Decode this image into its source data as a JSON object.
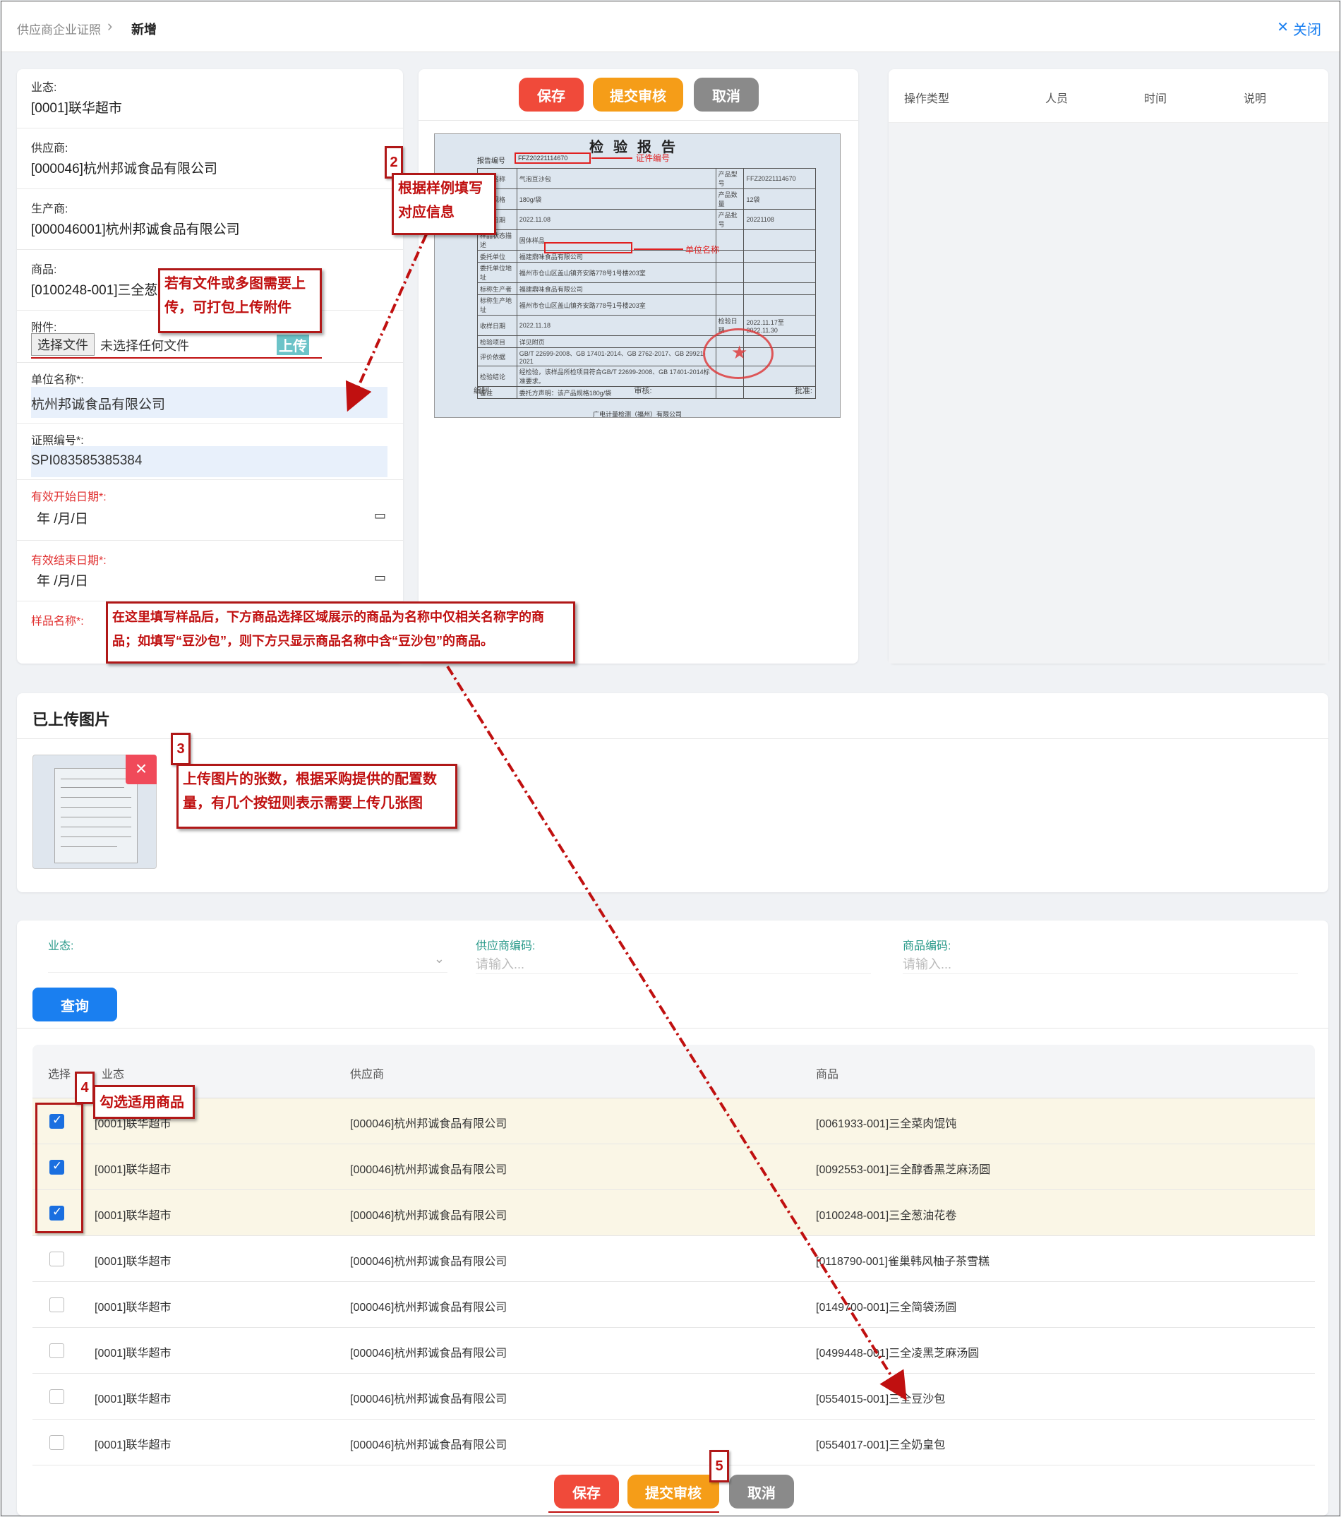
{
  "breadcrumb": {
    "parent": "供应商企业证照",
    "current": "新增"
  },
  "close_label": "关闭",
  "form": {
    "business_label": "业态:",
    "business_value": "[0001]联华超市",
    "supplier_label": "供应商:",
    "supplier_value": "[000046]杭州邦诚食品有限公司",
    "producer_label": "生产商:",
    "producer_value": "[000046001]杭州邦诚食品有限公司",
    "product_label": "商品:",
    "product_value": "[0100248-001]三全葱",
    "attach_label": "附件:",
    "choose_file": "选择文件",
    "no_file": "未选择任何文件",
    "upload": "上传",
    "unit_label": "单位名称*:",
    "unit_value": "杭州邦诚食品有限公司",
    "license_label": "证照编号*:",
    "license_value": "SPI083585385384",
    "start_label": "有效开始日期*:",
    "start_value": "年 /月/日",
    "end_label": "有效结束日期*:",
    "end_value": "年 /月/日",
    "sample_label": "样品名称*:"
  },
  "toolbar": {
    "save": "保存",
    "submit": "提交审核",
    "cancel": "取消"
  },
  "report": {
    "title": "检验报告",
    "no_label": "报告编号",
    "no_value": "FFZ20221114670",
    "no_tag": "证件编号",
    "unit_tag": "单位名称",
    "rows": [
      [
        "产品名称",
        "气泡豆沙包",
        "产品型号",
        "FFZ20221114670"
      ],
      [
        "产品规格",
        "180g/袋",
        "产品数量",
        "12袋"
      ],
      [
        "生产日期",
        "2022.11.08",
        "产品批号",
        "20221108"
      ],
      [
        "样品状态描述",
        "固体样品",
        "",
        ""
      ],
      [
        "委托单位",
        "福建鼎味食品有限公司",
        "",
        ""
      ],
      [
        "委托单位地址",
        "福州市仓山区盖山镇齐安路778号1号楼203室",
        "",
        ""
      ],
      [
        "标称生产者",
        "福建鼎味食品有限公司",
        "",
        ""
      ],
      [
        "标称生产地址",
        "福州市仓山区盖山镇齐安路778号1号楼203室",
        "",
        ""
      ],
      [
        "收样日期",
        "2022.11.18",
        "检验日期",
        "2022.11.17至2022.11.30"
      ],
      [
        "检验项目",
        "详见附页",
        "",
        ""
      ],
      [
        "评价依据",
        "GB/T 22699-2008、GB 17401-2014、GB 2762-2017、GB 29921-2021",
        "",
        ""
      ],
      [
        "检验结论",
        "经检验，该样品所检项目符合GB/T 22699-2008、GB 17401-2014标准要求。",
        "",
        ""
      ],
      [
        "备注",
        "委托方声明：该产品规格180g/袋",
        "",
        ""
      ]
    ],
    "signer1": "编制:",
    "signer2": "审核:",
    "signer3": "批准:",
    "footer": "广电计量检测（福州）有限公司"
  },
  "log": {
    "headers": [
      "操作类型",
      "人员",
      "时间",
      "说明"
    ]
  },
  "uploaded": {
    "title": "已上传图片",
    "remove": "×"
  },
  "search": {
    "business_label": "业态:",
    "supplier_code_label": "供应商编码:",
    "supplier_code_placeholder": "请输入...",
    "product_code_label": "商品编码:",
    "product_code_placeholder": "请输入...",
    "query": "查询"
  },
  "table": {
    "headers": [
      "选择",
      "业态",
      "供应商",
      "商品"
    ],
    "rows": [
      {
        "checked": true,
        "business": "[0001]联华超市",
        "supplier": "[000046]杭州邦诚食品有限公司",
        "product": "[0061933-001]三全菜肉馄饨"
      },
      {
        "checked": true,
        "business": "[0001]联华超市",
        "supplier": "[000046]杭州邦诚食品有限公司",
        "product": "[0092553-001]三全醇香黑芝麻汤圆"
      },
      {
        "checked": true,
        "business": "[0001]联华超市",
        "supplier": "[000046]杭州邦诚食品有限公司",
        "product": "[0100248-001]三全葱油花卷"
      },
      {
        "checked": false,
        "business": "[0001]联华超市",
        "supplier": "[000046]杭州邦诚食品有限公司",
        "product": "[0118790-001]雀巢韩风柚子茶雪糕"
      },
      {
        "checked": false,
        "business": "[0001]联华超市",
        "supplier": "[000046]杭州邦诚食品有限公司",
        "product": "[0149700-001]三全简袋汤圆"
      },
      {
        "checked": false,
        "business": "[0001]联华超市",
        "supplier": "[000046]杭州邦诚食品有限公司",
        "product": "[0499448-001]三全凌黑芝麻汤圆"
      },
      {
        "checked": false,
        "business": "[0001]联华超市",
        "supplier": "[000046]杭州邦诚食品有限公司",
        "product": "[0554015-001]三全豆沙包"
      },
      {
        "checked": false,
        "business": "[0001]联华超市",
        "supplier": "[000046]杭州邦诚食品有限公司",
        "product": "[0554017-001]三全奶皇包"
      }
    ]
  },
  "annotations": {
    "n2": "2",
    "a2": "根据样例填写对应信息",
    "a_attach": "若有文件或多图需要上传，可打包上传附件",
    "a_sample": "在这里填写样品后，下方商品选择区域展示的商品为名称中仅相关名称字的商品；如填写“豆沙包”，则下方只显示商品名称中含“豆沙包”的商品。",
    "n3": "3",
    "a3": "上传图片的张数，根据采购提供的配置数量，有几个按钮则表示需要上传几张图",
    "n4": "4",
    "a4": "勾选适用商品",
    "n5": "5"
  },
  "colors": {
    "primary": "#1a7ff0",
    "save": "#f04a3a",
    "submit": "#f59d18",
    "cancel": "#8a8a8a",
    "annotation": "#c01010"
  }
}
